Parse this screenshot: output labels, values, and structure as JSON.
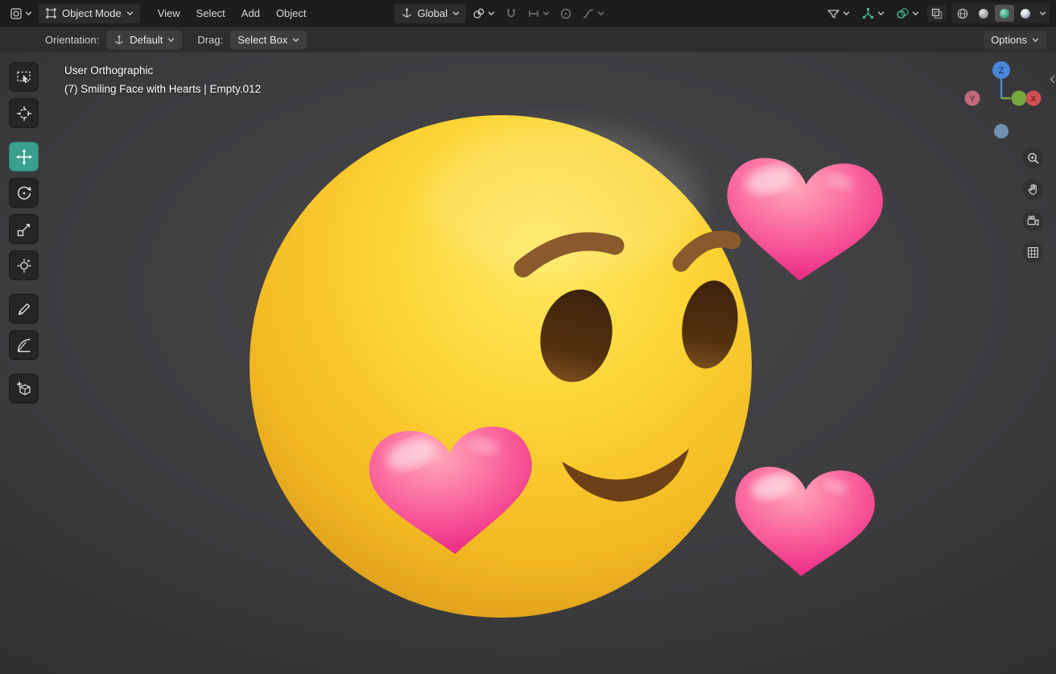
{
  "colors": {
    "accent_teal": "#3aa08c",
    "header_bg": "#1d1d1d",
    "tool_settings_bg": "#2e2e2e",
    "viewport_bg": "#3c3c3f",
    "face_yellow": "#fcd435",
    "heart_pink": "#ec1e7b",
    "axis_x_red": "#cf4f55",
    "axis_y_green": "#74a83e",
    "axis_z_blue": "#4a86d8"
  },
  "topbar": {
    "mode_label": "Object Mode",
    "menus": [
      "View",
      "Select",
      "Add",
      "Object"
    ],
    "orientation_label": "Global"
  },
  "tool_settings": {
    "orientation_label": "Orientation:",
    "orientation_value": "Default",
    "drag_label": "Drag:",
    "drag_value": "Select Box",
    "options_label": "Options"
  },
  "viewport": {
    "header_line1": "User Orthographic",
    "header_line2": "(7) Smiling Face with Hearts | Empty.012",
    "gizmo": {
      "x": "X",
      "y": "Y",
      "z": "Z"
    }
  },
  "tools": {
    "active_tool": "move",
    "items": [
      "select-box",
      "cursor",
      "move",
      "rotate",
      "scale",
      "transform",
      "annotate",
      "measure",
      "add-cube"
    ]
  },
  "icons": {
    "editor_type": "3d-viewport-editor-icon",
    "mode": "object-mode-icon",
    "orientation": "transform-orientation-icon",
    "pivot": "pivot-point-icon",
    "snap": "magnet-icon",
    "snap_target": "snap-target-icon",
    "proportional": "proportional-editing-icon",
    "falloff": "falloff-curve-icon",
    "visibility": "object-visibility-icon",
    "gizmos": "gizmos-toggle-icon",
    "overlays": "overlays-toggle-icon",
    "xray": "xray-toggle-icon",
    "shading": [
      "wireframe-icon",
      "solid-icon",
      "material-preview-icon",
      "rendered-icon"
    ],
    "nav": [
      "zoom-icon",
      "pan-hand-icon",
      "camera-view-icon",
      "grid-ortho-icon"
    ]
  }
}
